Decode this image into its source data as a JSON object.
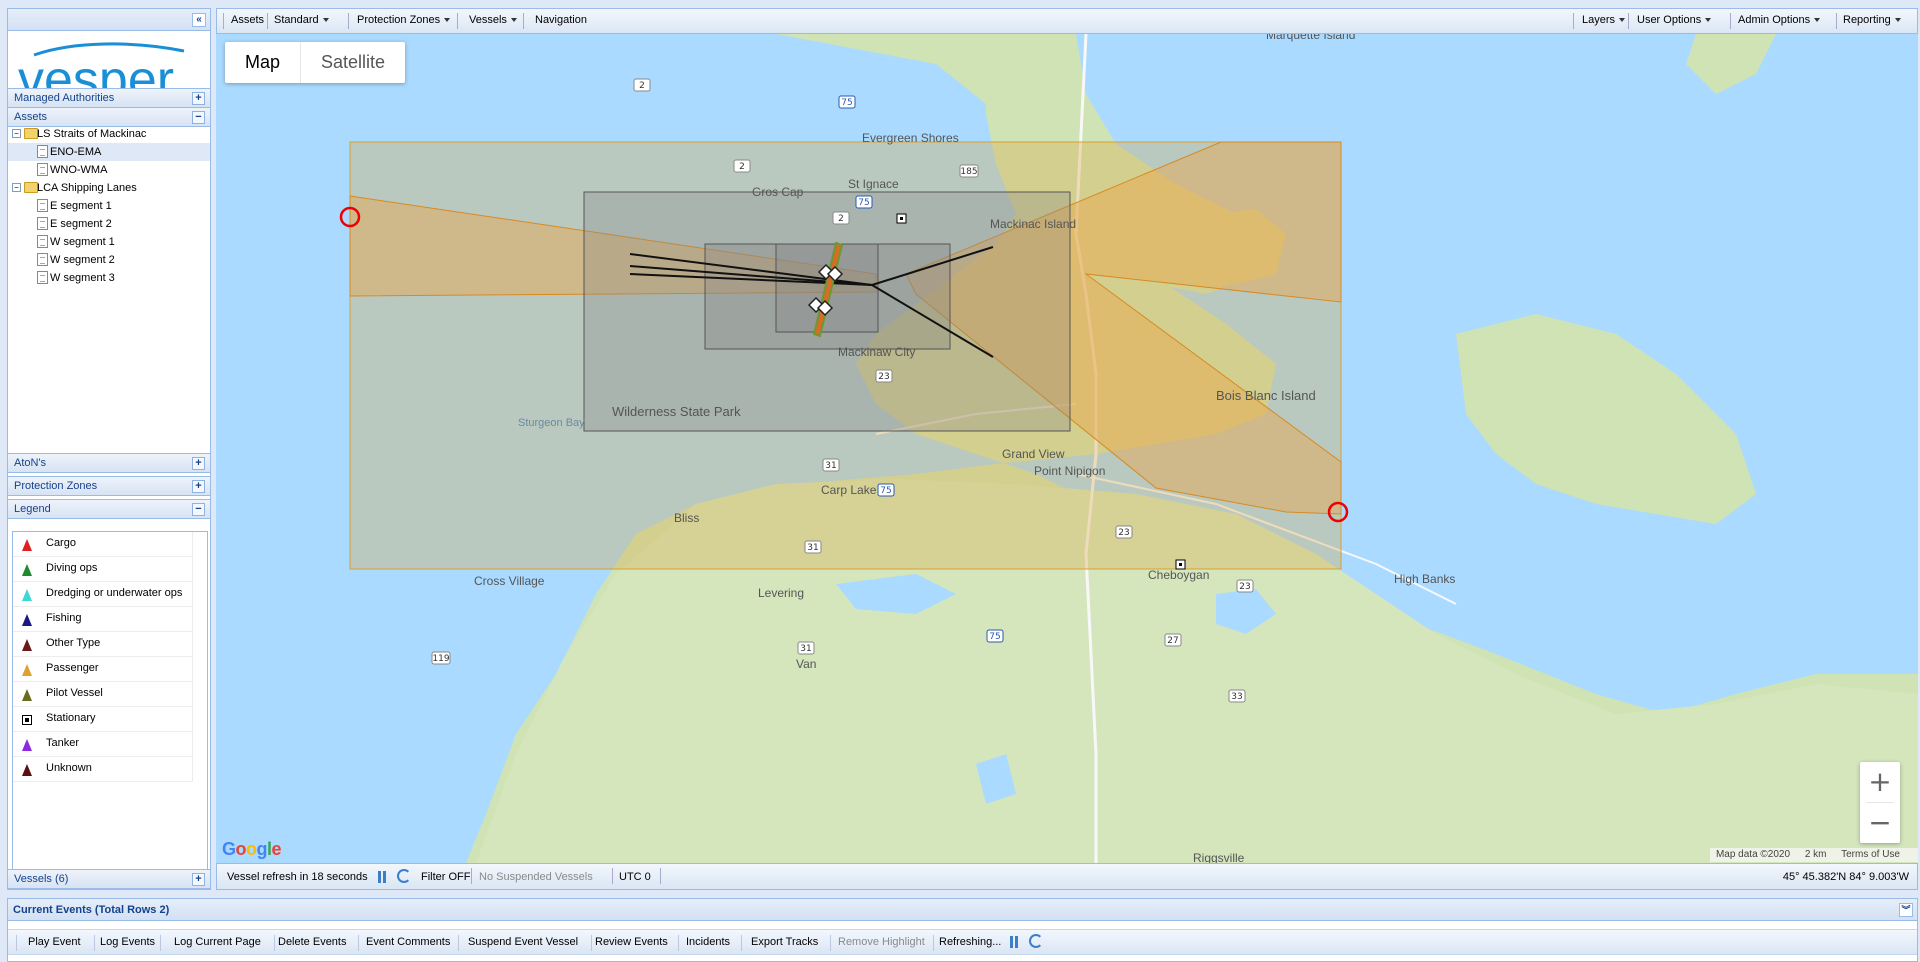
{
  "topbar": {
    "left_items": [
      "Assets",
      "Standard",
      "Protection Zones",
      "Vessels",
      "Navigation"
    ],
    "right_items": [
      "Layers",
      "User Options",
      "Admin Options",
      "Reporting"
    ]
  },
  "logo": {
    "text": "vesper",
    "color": "#1a8fd6"
  },
  "sidebar": {
    "managed_authorities": "Managed Authorities",
    "assets": "Assets",
    "tree": [
      {
        "label": "LS Straits of Mackinac",
        "type": "folder"
      },
      {
        "label": "ENO-EMA",
        "type": "doc",
        "selected": true
      },
      {
        "label": "WNO-WMA",
        "type": "doc"
      },
      {
        "label": "LCA Shipping Lanes",
        "type": "folder"
      },
      {
        "label": "E segment 1",
        "type": "doc"
      },
      {
        "label": "E segment 2",
        "type": "doc"
      },
      {
        "label": "W segment 1",
        "type": "doc"
      },
      {
        "label": "W segment 2",
        "type": "doc"
      },
      {
        "label": "W segment 3",
        "type": "doc"
      }
    ],
    "atons": "AtoN's",
    "protection_zones": "Protection Zones",
    "legend_title": "Legend",
    "vessels": "Vessels (6)"
  },
  "legend": [
    {
      "label": "Cargo",
      "icon": "triangle",
      "color": "#e02020"
    },
    {
      "label": "Diving ops",
      "icon": "triangle",
      "color": "#1e8a2e"
    },
    {
      "label": "Dredging or underwater ops",
      "icon": "triangle",
      "color": "#3ed6d6"
    },
    {
      "label": "Fishing",
      "icon": "triangle",
      "color": "#1a1a80"
    },
    {
      "label": "Other Type",
      "icon": "triangle",
      "color": "#6a1a1a"
    },
    {
      "label": "Passenger",
      "icon": "triangle",
      "color": "#e0a030"
    },
    {
      "label": "Pilot Vessel",
      "icon": "triangle",
      "color": "#6a6a20"
    },
    {
      "label": "Stationary",
      "icon": "square",
      "color": "#000000"
    },
    {
      "label": "Tanker",
      "icon": "triangle",
      "color": "#8a2be2"
    },
    {
      "label": "Unknown",
      "icon": "triangle",
      "color": "#5a1010"
    }
  ],
  "map": {
    "map_type": [
      "Map",
      "Satellite"
    ],
    "active_type": "Map",
    "zoom_in": "+",
    "zoom_out": "−",
    "google": "Google",
    "attribution": [
      "Map data ©2020",
      "2 km",
      "Terms of Use"
    ],
    "labels": [
      "Marquette Island",
      "Evergreen Shores",
      "St Ignace",
      "Gros Cap",
      "Mackinac Island",
      "Mackinaw City",
      "Wilderness State Park",
      "Sturgeon Bay",
      "Bois Blanc Island",
      "Grand View",
      "Point Nipigon",
      "Carp Lake",
      "Bliss",
      "Cross Village",
      "Levering",
      "Cheboygan",
      "High Banks",
      "Van",
      "Riggsville"
    ],
    "highways": [
      "2",
      "75",
      "2",
      "185",
      "2",
      "75",
      "23",
      "31",
      "75",
      "31",
      "23",
      "23",
      "31",
      "75",
      "119",
      "33",
      "27"
    ],
    "colors": {
      "water": "#aadaff",
      "land": "#cfe3b4",
      "zone": "#f0b040",
      "box": "#888888"
    }
  },
  "statusbar": {
    "refresh": "Vessel refresh in 18 seconds",
    "filter": "Filter OFF",
    "suspended": "No Suspended Vessels",
    "utc": "UTC 0",
    "coords": "45° 45.382'N 84° 9.003'W"
  },
  "events": {
    "title": "Current Events (Total Rows 2)",
    "buttons": [
      "Play Event",
      "Log Events",
      "Log Current Page",
      "Delete Events",
      "Event Comments",
      "Suspend Event Vessel",
      "Review Events",
      "Incidents",
      "Export Tracks",
      "Remove Highlight",
      "Refreshing..."
    ],
    "disabled": [
      "Remove Highlight"
    ]
  }
}
